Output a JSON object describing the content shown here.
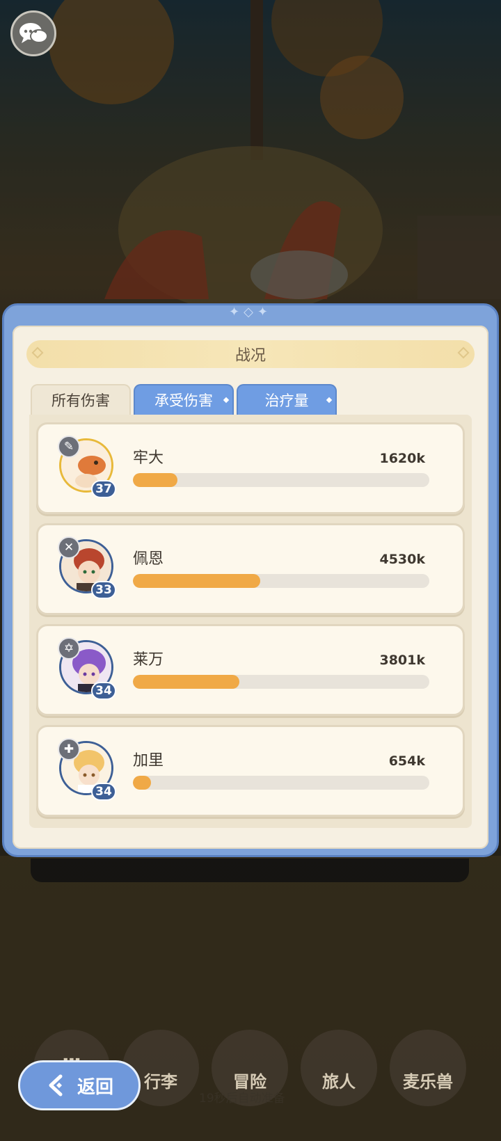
{
  "panel": {
    "title": "战况",
    "tabs": [
      {
        "label": "所有伤害",
        "active": true
      },
      {
        "label": "承受伤害",
        "active": false
      },
      {
        "label": "治疗量",
        "active": false
      }
    ]
  },
  "entries": [
    {
      "name": "牢大",
      "value": "1620k",
      "level": "37",
      "fill_fraction": 0.15,
      "role_icon": "pin-icon"
    },
    {
      "name": "佩恩",
      "value": "4530k",
      "level": "33",
      "fill_fraction": 0.43,
      "role_icon": "crossed-swords-icon"
    },
    {
      "name": "莱万",
      "value": "3801k",
      "level": "34",
      "fill_fraction": 0.36,
      "role_icon": "hexagram-icon"
    },
    {
      "name": "加里",
      "value": "654k",
      "level": "34",
      "fill_fraction": 0.06,
      "role_icon": "cross-icon"
    }
  ],
  "bottom_nav": {
    "items": [
      "行李",
      "冒险",
      "旅人",
      "麦乐兽"
    ],
    "auto_ready_text": "19秒后自动准备"
  },
  "back_button": {
    "label": "返回"
  },
  "colors": {
    "bar_fill": "#f0a946",
    "panel_blue": "#7ea3da",
    "tab_blue": "#6f9de3"
  }
}
